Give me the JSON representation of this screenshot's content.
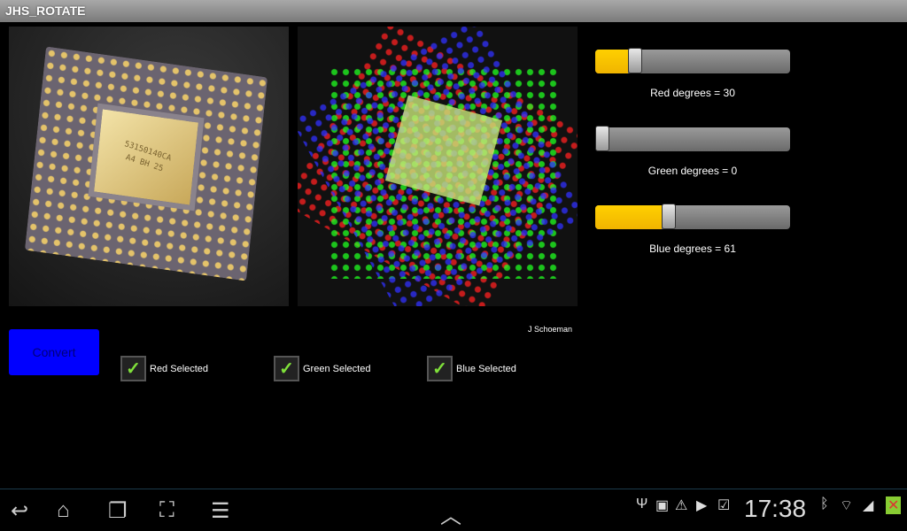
{
  "app": {
    "title": "JHS_ROTATE"
  },
  "images": {
    "original_alt": "CPU chip original",
    "rotated_alt": "CPU chip RGB rotated",
    "credit": "J Schoeman",
    "chip_text": "53150140CA A4 BH 25"
  },
  "convert_label": "Convert",
  "checkboxes": [
    {
      "label": "Red Selected",
      "checked": true
    },
    {
      "label": "Green Selected",
      "checked": true
    },
    {
      "label": "Blue Selected",
      "checked": true
    }
  ],
  "sliders": [
    {
      "label": "Red degrees = 30",
      "value": 30,
      "max": 180
    },
    {
      "label": "Green degrees = 0",
      "value": 0,
      "max": 180
    },
    {
      "label": "Blue degrees = 61",
      "value": 61,
      "max": 180
    }
  ],
  "colors": {
    "accent": "#ffc800",
    "button": "#0000ff"
  },
  "statusbar": {
    "time": "17:38",
    "icons": [
      "usb-icon",
      "sd-card-icon",
      "warning-icon",
      "play-store-icon",
      "task-icon",
      "bluetooth-icon",
      "wifi-icon",
      "signal-icon",
      "battery-icon"
    ]
  }
}
